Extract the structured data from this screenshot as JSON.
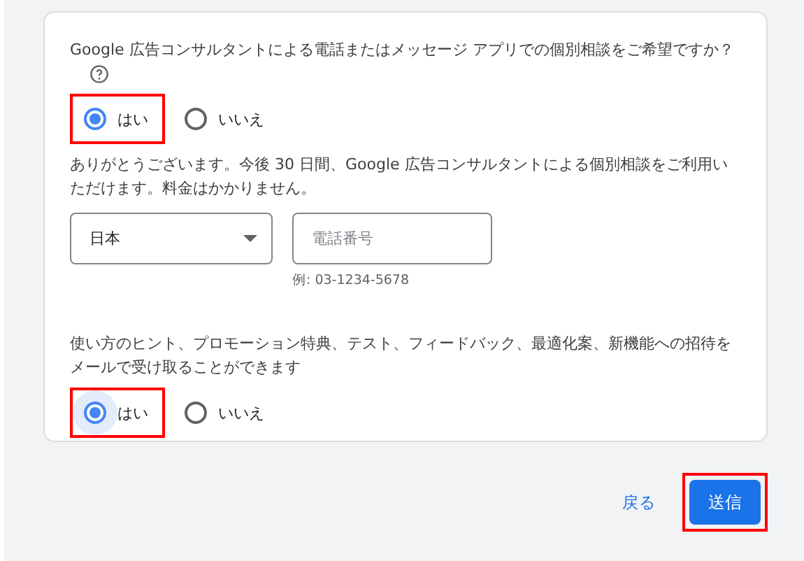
{
  "consult": {
    "question": "Google 広告コンサルタントによる電話またはメッセージ アプリでの個別相談をご希望ですか？",
    "options": [
      {
        "label": "はい",
        "selected": true,
        "highlighted": true
      },
      {
        "label": "いいえ",
        "selected": false,
        "highlighted": false
      }
    ],
    "note": "ありがとうございます。今後 30 日間、Google 広告コンサルタントによる個別相談をご利用いただけます。料金はかかりません。",
    "country": {
      "value": "日本"
    },
    "phone": {
      "placeholder": "電話番号",
      "hint": "例: 03-1234-5678"
    }
  },
  "email": {
    "question": "使い方のヒント、プロモーション特典、テスト、フィードバック、最適化案、新機能への招待をメールで受け取ることができます",
    "options": [
      {
        "label": "はい",
        "selected": true,
        "highlighted": true,
        "focused": true
      },
      {
        "label": "いいえ",
        "selected": false,
        "highlighted": false,
        "focused": false
      }
    ]
  },
  "actions": [
    {
      "kind": "link",
      "label": "戻る",
      "highlighted": false
    },
    {
      "kind": "primary",
      "label": "送信",
      "highlighted": true
    }
  ]
}
